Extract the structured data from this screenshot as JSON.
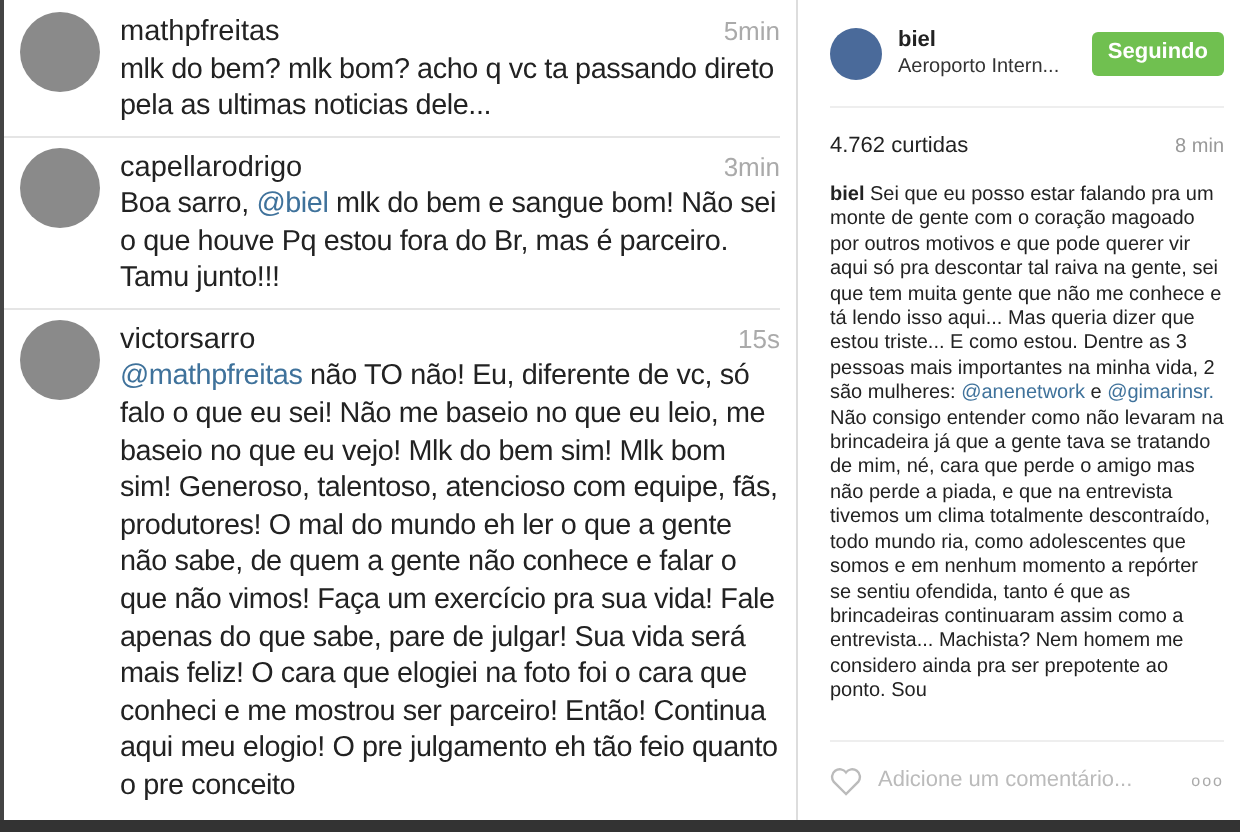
{
  "comments": [
    {
      "username": "mathpfreitas",
      "time": "5min",
      "parts": [
        {
          "kind": "text",
          "text": "mlk do bem? mlk bom? acho q vc ta passando direto pela as ultimas noticias dele..."
        }
      ]
    },
    {
      "username": "capellarodrigo",
      "time": "3min",
      "parts": [
        {
          "kind": "text",
          "text": "Boa sarro, "
        },
        {
          "kind": "mention",
          "text": "@biel"
        },
        {
          "kind": "text",
          "text": " mlk do bem e sangue bom! Não sei o que houve Pq estou fora do Br, mas é parceiro. Tamu junto!!!"
        }
      ]
    },
    {
      "username": "victorsarro",
      "time": "15s",
      "parts": [
        {
          "kind": "mention",
          "text": "@mathpfreitas"
        },
        {
          "kind": "text",
          "text": " não TO não! Eu, diferente de vc, só falo o que eu sei! Não me baseio no que eu leio, me baseio no que eu vejo! Mlk do bem sim! Mlk bom sim! Generoso, talentoso, atencioso com equipe, fãs, produtores! O mal do mundo eh ler o que a gente não sabe, de quem a gente não conhece e falar o que não vimos! Faça um exercício pra sua vida! Fale apenas do que sabe, pare de julgar! Sua vida será mais feliz! O cara que elogiei na foto foi o cara que conheci e me mostrou ser parceiro! Então! Continua aqui meu elogio! O pre julgamento eh tão feio quanto o pre conceito"
        }
      ]
    }
  ],
  "post": {
    "username": "biel",
    "location": "Aeroporto Intern...",
    "follow_button": "Seguindo",
    "likes": "4.762 curtidas",
    "time": "8 min",
    "caption": [
      {
        "kind": "author",
        "text": "biel"
      },
      {
        "kind": "text",
        "text": " Sei que eu posso estar falando pra um monte de gente com o coração magoado por outros motivos e que pode querer vir aqui só pra descontar tal raiva na gente, sei que tem muita gente que não me conhece e tá lendo isso aqui... Mas queria dizer que estou triste... E como estou. Dentre as 3 pessoas mais importantes na minha vida, 2 são mulheres: "
      },
      {
        "kind": "mention",
        "text": "@anenetwork"
      },
      {
        "kind": "text",
        "text": " e "
      },
      {
        "kind": "mention",
        "text": "@gimarinsr."
      },
      {
        "kind": "text",
        "text": " Não consigo entender como não levaram na brincadeira já que a gente tava se tratando de mim, né, cara que perde o amigo mas não perde a piada, e que na entrevista tivemos um clima totalmente descontraído, todo mundo ria, como adolescentes que somos e em nenhum momento a repórter se sentiu ofendida, tanto é que as brincadeiras continuaram assim como a entrevista... Machista? Nem homem me considero ainda pra ser prepotente ao ponto. Sou"
      }
    ],
    "comment_placeholder": "Adicione um comentário...",
    "more_button": "ooo"
  }
}
